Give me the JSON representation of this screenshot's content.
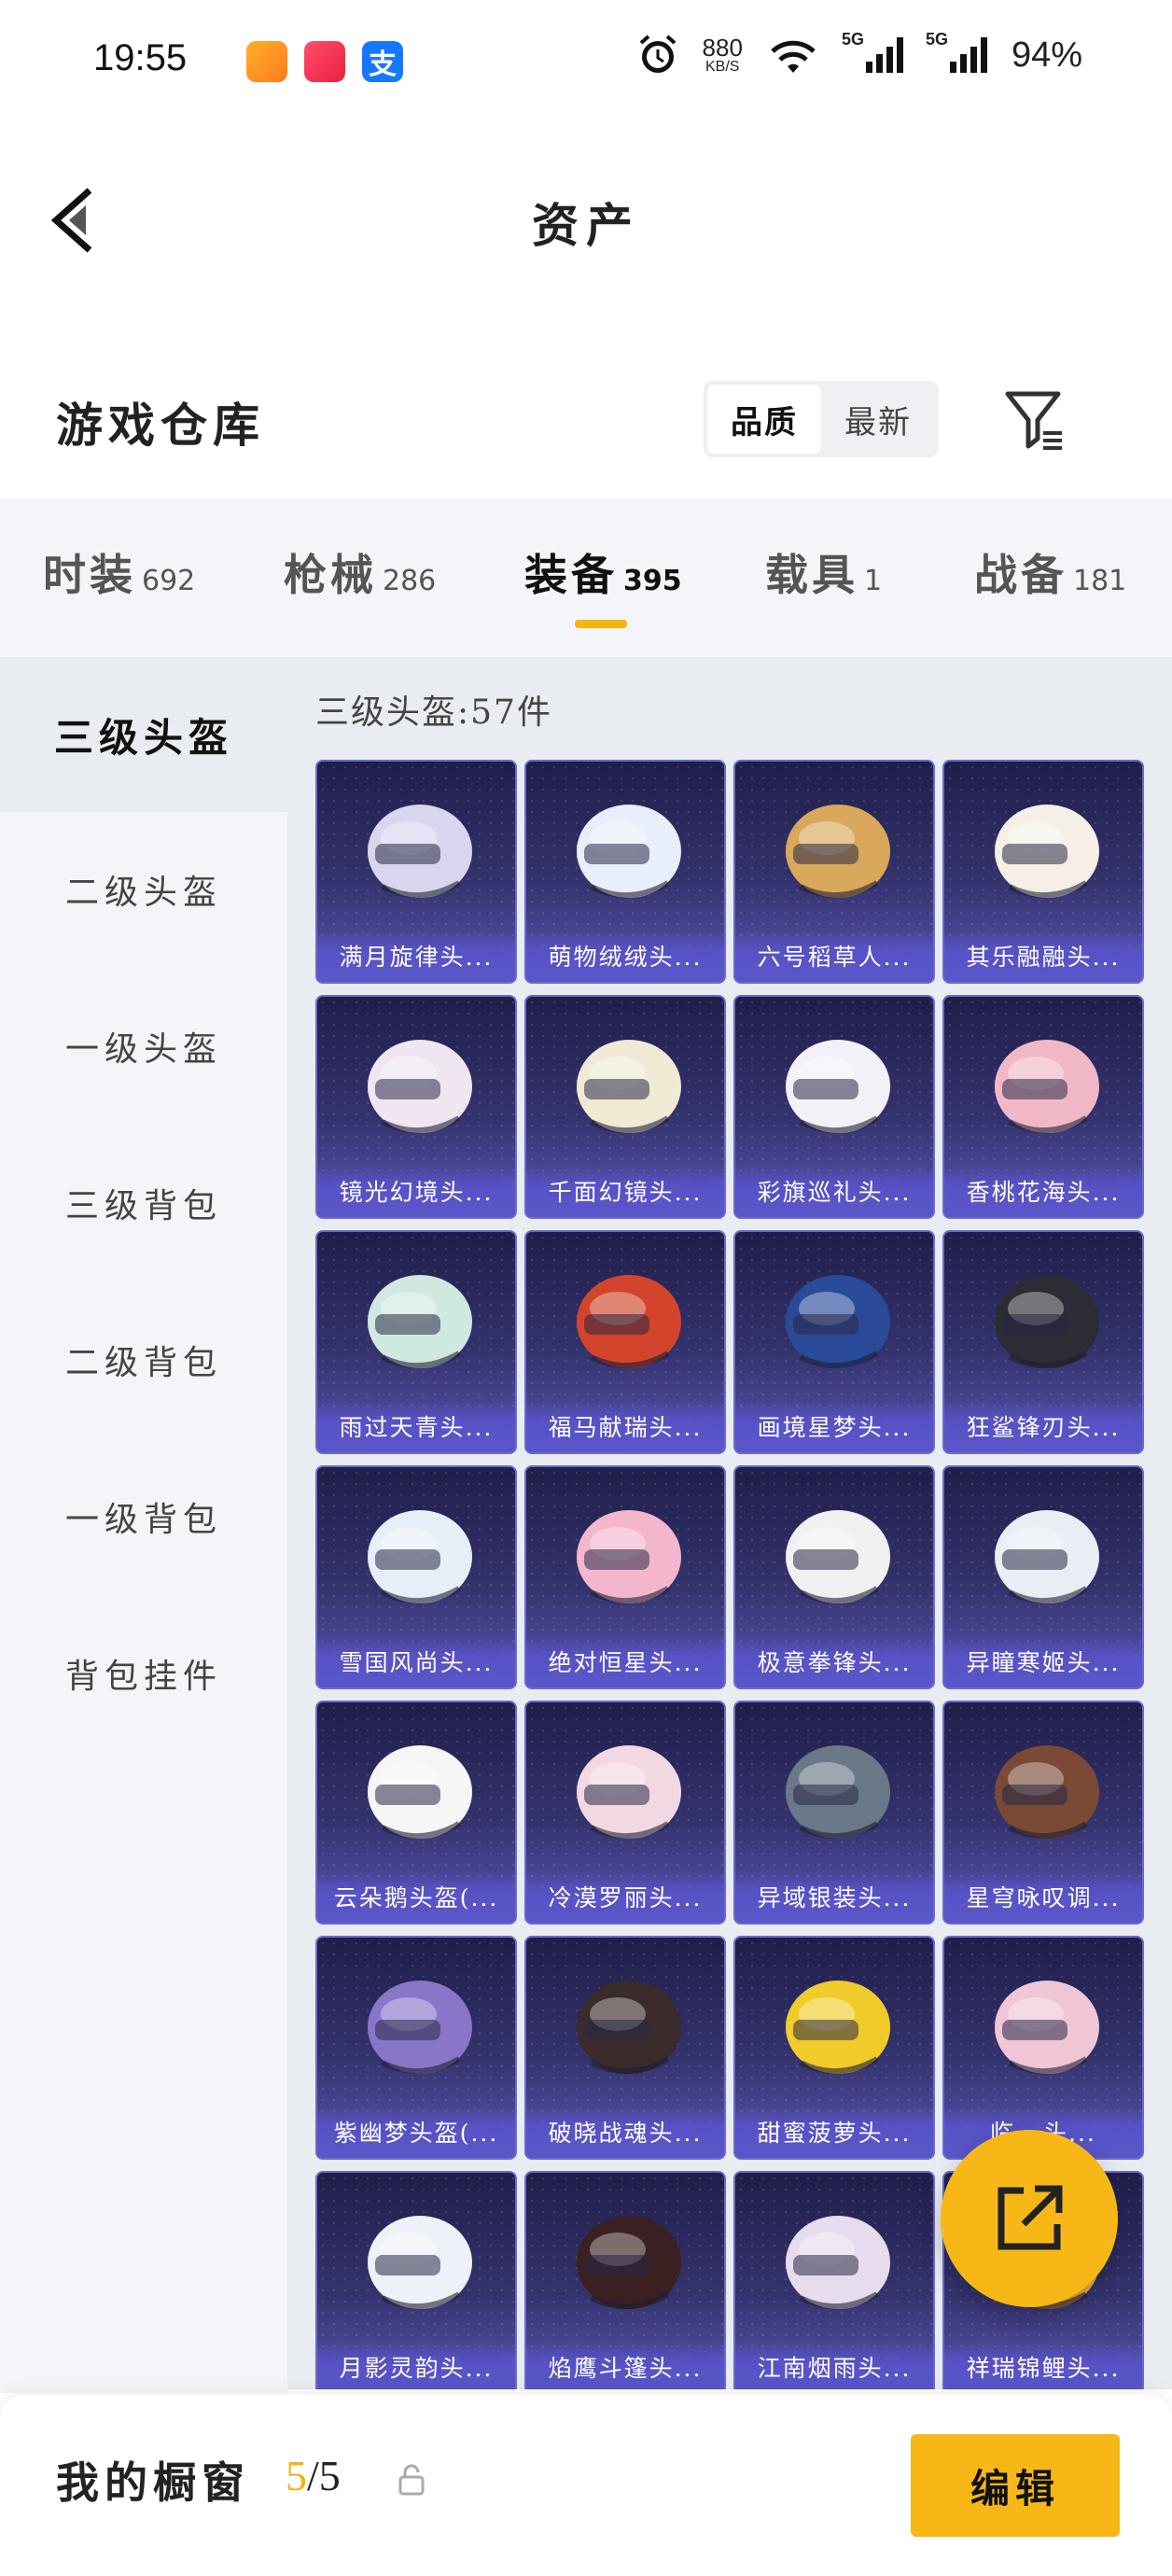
{
  "status_bar": {
    "time": "19:55",
    "net_speed": "880",
    "net_unit": "KB/S",
    "signal1": "5G",
    "signal2": "5G",
    "battery": "94%"
  },
  "nav": {
    "title": "资产"
  },
  "warehouse": {
    "title": "游戏仓库",
    "sort_options": [
      "品质",
      "最新"
    ],
    "active_sort": "品质"
  },
  "tabs": [
    {
      "label": "时装",
      "count": "692"
    },
    {
      "label": "枪械",
      "count": "286"
    },
    {
      "label": "装备",
      "count": "395"
    },
    {
      "label": "载具",
      "count": "1"
    },
    {
      "label": "战备",
      "count": "181"
    }
  ],
  "active_tab": "装备",
  "sidebar": {
    "items": [
      "三级头盔",
      "二级头盔",
      "一级头盔",
      "三级背包",
      "二级背包",
      "一级背包",
      "背包挂件"
    ],
    "active": "三级头盔"
  },
  "content": {
    "count_label": "三级头盔:57件"
  },
  "items": [
    {
      "name": "满月旋律头...",
      "color": "#d8d6ee"
    },
    {
      "name": "萌物绒绒头...",
      "color": "#e9eefb"
    },
    {
      "name": "六号稻草人...",
      "color": "#d9a85a"
    },
    {
      "name": "其乐融融头...",
      "color": "#f5efe6"
    },
    {
      "name": "镜光幻境头...",
      "color": "#efe6f2"
    },
    {
      "name": "千面幻镜头...",
      "color": "#f0ead4"
    },
    {
      "name": "彩旗巡礼头...",
      "color": "#f3f1f8"
    },
    {
      "name": "香桃花海头...",
      "color": "#f0b8c6"
    },
    {
      "name": "雨过天青头...",
      "color": "#cfe8e0"
    },
    {
      "name": "福马献瑞头...",
      "color": "#d2452c"
    },
    {
      "name": "画境星梦头...",
      "color": "#2a4a9a"
    },
    {
      "name": "狂鲨锋刃头...",
      "color": "#2c2c34"
    },
    {
      "name": "雪国风尚头...",
      "color": "#e6eef8"
    },
    {
      "name": "绝对恒星头...",
      "color": "#f3b6cc"
    },
    {
      "name": "极意拳锋头...",
      "color": "#f1f1f1"
    },
    {
      "name": "异瞳寒姬头...",
      "color": "#e8eef4"
    },
    {
      "name": "云朵鹅头盔(...",
      "color": "#f6f6f6"
    },
    {
      "name": "冷漠罗丽头...",
      "color": "#f2d8e0"
    },
    {
      "name": "异域银装头...",
      "color": "#6a7888"
    },
    {
      "name": "星穹咏叹调...",
      "color": "#7a4a36"
    },
    {
      "name": "紫幽梦头盔(...",
      "color": "#8a76c8"
    },
    {
      "name": "破晓战魂头...",
      "color": "#3a2c2c"
    },
    {
      "name": "甜蜜菠萝头...",
      "color": "#f0cc2a"
    },
    {
      "name": "临...头...",
      "color": "#f0c6d6"
    },
    {
      "name": "月影灵韵头...",
      "color": "#eef2f8"
    },
    {
      "name": "焰鹰斗篷头...",
      "color": "#3a2020"
    },
    {
      "name": "江南烟雨头...",
      "color": "#e6dcee"
    },
    {
      "name": "祥瑞锦鲤头...",
      "color": "#f2b04a"
    }
  ],
  "showcase": {
    "label": "我的橱窗",
    "used": "5",
    "total": "/5",
    "edit_label": "编辑"
  },
  "icons": {
    "back": "back-arrow-icon",
    "filter": "filter-icon",
    "share": "share-icon",
    "lock": "lock-icon"
  },
  "colors": {
    "accent": "#f7b817",
    "card_bg": "#2c2a60"
  }
}
